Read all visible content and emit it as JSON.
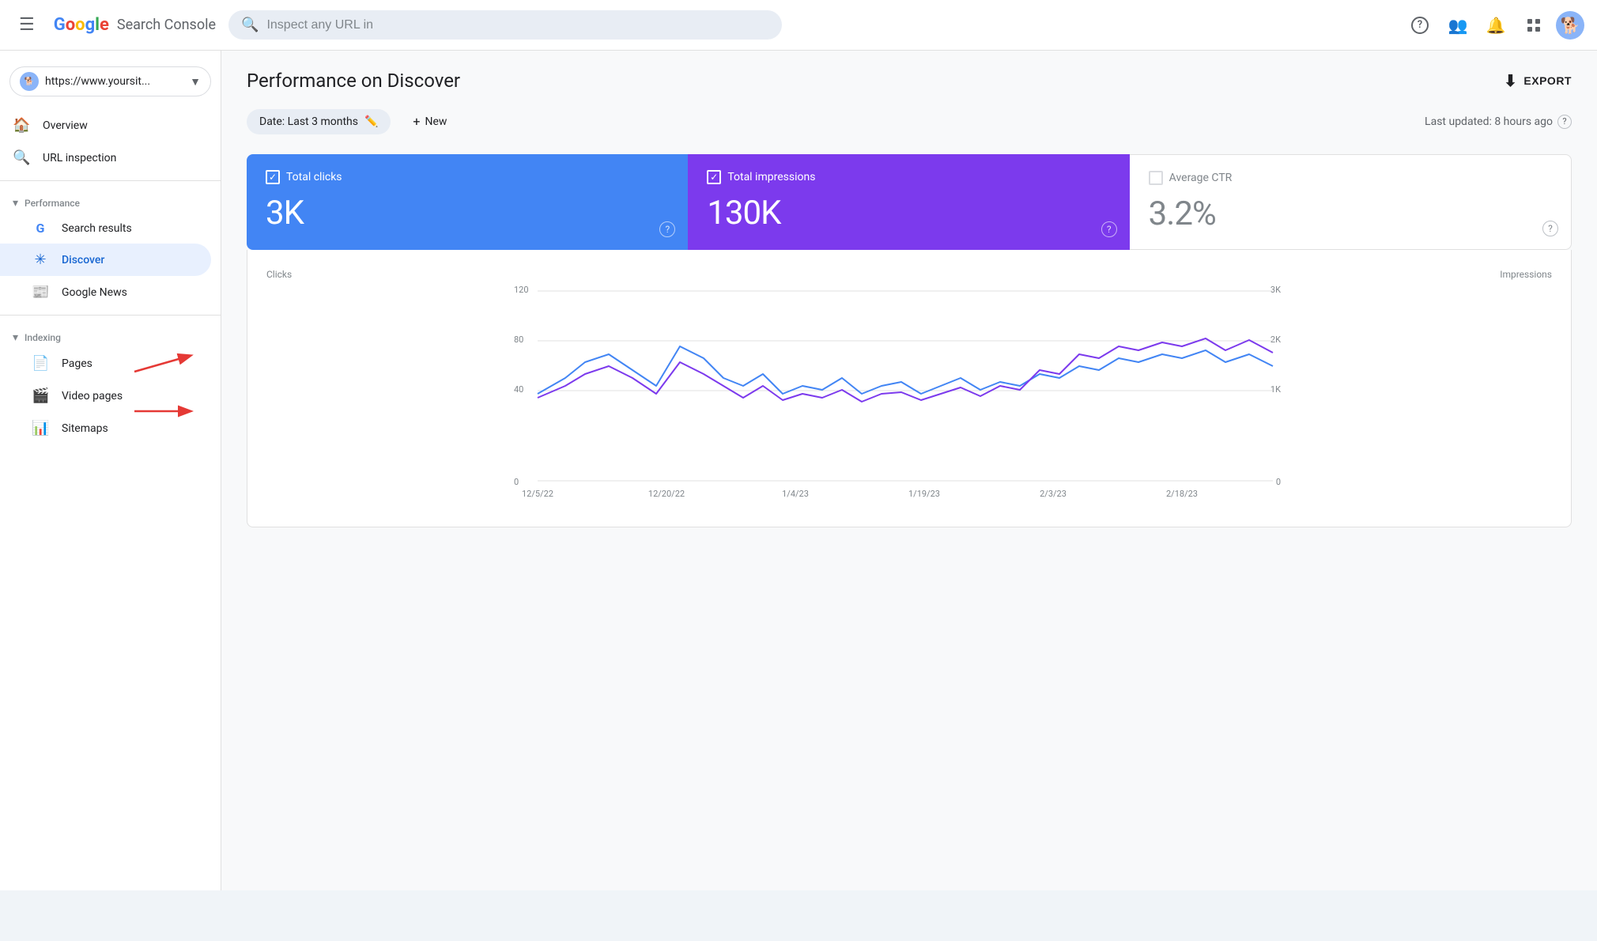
{
  "header": {
    "menu_icon": "☰",
    "logo": {
      "google": "Google",
      "product": "Search Console"
    },
    "search_placeholder": "Inspect any URL in",
    "icons": {
      "help": "?",
      "accounts": "👤",
      "bell": "🔔",
      "grid": "⋮⋮⋮"
    }
  },
  "sidebar": {
    "property": {
      "url": "https://www.yoursit...",
      "favicon": "🐕"
    },
    "nav_items": [
      {
        "id": "overview",
        "label": "Overview",
        "icon": "🏠",
        "active": false
      },
      {
        "id": "url-inspection",
        "label": "URL inspection",
        "icon": "🔍",
        "active": false
      },
      {
        "id": "performance",
        "section_label": "Performance",
        "collapsed": false
      },
      {
        "id": "search-results",
        "label": "Search results",
        "icon": "G",
        "active": false,
        "indent": true
      },
      {
        "id": "discover",
        "label": "Discover",
        "icon": "✳",
        "active": true,
        "indent": true
      },
      {
        "id": "google-news",
        "label": "Google News",
        "icon": "📰",
        "active": false,
        "indent": true
      },
      {
        "id": "indexing",
        "section_label": "Indexing",
        "collapsed": false
      },
      {
        "id": "pages",
        "label": "Pages",
        "icon": "📄",
        "active": false,
        "indent": true
      },
      {
        "id": "video-pages",
        "label": "Video pages",
        "icon": "🎬",
        "active": false,
        "indent": true
      },
      {
        "id": "sitemaps",
        "label": "Sitemaps",
        "icon": "📊",
        "active": false,
        "indent": true
      }
    ]
  },
  "main": {
    "page_title": "Performance on Discover",
    "export_label": "EXPORT",
    "filter": {
      "date_label": "Date: Last 3 months",
      "new_label": "New"
    },
    "last_updated": "Last updated: 8 hours ago",
    "metrics": [
      {
        "id": "total-clicks",
        "label": "Total clicks",
        "value": "3K",
        "checked": true,
        "color": "blue"
      },
      {
        "id": "total-impressions",
        "label": "Total impressions",
        "value": "130K",
        "checked": true,
        "color": "purple"
      },
      {
        "id": "average-ctr",
        "label": "Average CTR",
        "value": "3.2%",
        "checked": false,
        "color": "white"
      }
    ],
    "chart": {
      "y_left_label": "Clicks",
      "y_right_label": "Impressions",
      "y_left_values": [
        "120",
        "80",
        "40",
        "0"
      ],
      "y_right_values": [
        "3K",
        "2K",
        "1K",
        "0"
      ],
      "x_labels": [
        "12/5/22",
        "12/20/22",
        "1/4/23",
        "1/19/23",
        "2/3/23",
        "2/18/23"
      ]
    }
  }
}
